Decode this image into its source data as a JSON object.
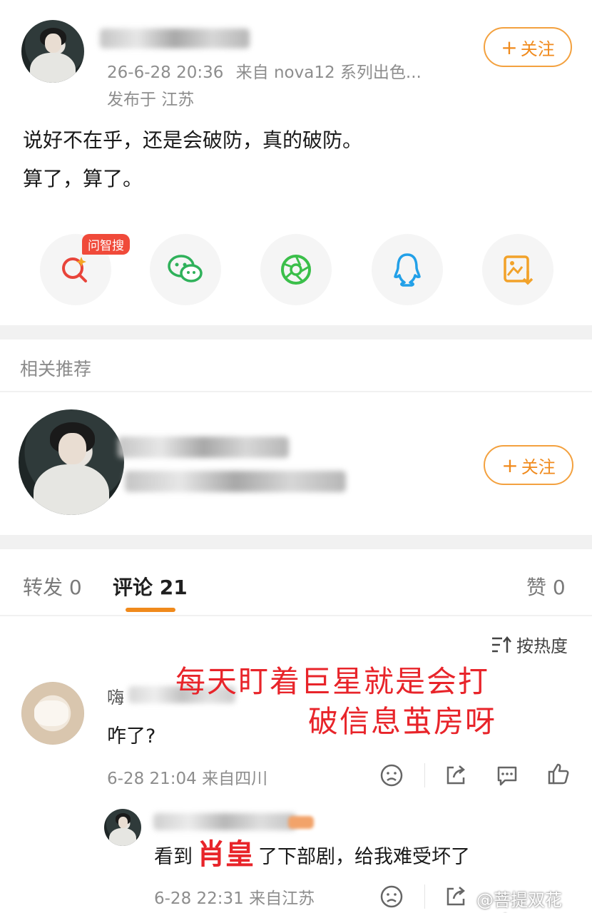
{
  "post": {
    "timestamp": "26-6-28 20:36",
    "source": "来自 nova12 系列出色...",
    "location": "发布于 江苏",
    "follow_label": "关注",
    "text_line1": "说好不在乎，还是会破防，真的破防。",
    "text_line2": "算了，算了。"
  },
  "share": {
    "badge": "问智搜",
    "items": [
      "search-ai-icon",
      "wechat-icon",
      "moments-icon",
      "qq-icon",
      "save-image-icon"
    ]
  },
  "recommend": {
    "header": "相关推荐",
    "follow_label": "关注"
  },
  "tabs": {
    "repost": "转发 0",
    "comments": "评论 21",
    "likes": "赞 0"
  },
  "sort": {
    "label": "按热度"
  },
  "overlay": {
    "line1": "每天盯着巨星就是会打",
    "line2": "破信息茧房呀"
  },
  "comment1": {
    "name_fragment": "嗨",
    "text": "咋了?",
    "meta": "6-28 21:04  来自四川"
  },
  "reply1": {
    "text_before": "看到",
    "highlight": "肖皇",
    "text_after": "了下部剧，给我难受坏了",
    "meta": "6-28 22:31  来自江苏"
  },
  "watermark": "@菩提双花yyds",
  "colors": {
    "accent_orange": "#f08a1c",
    "overlay_red": "#e8242a",
    "badge_red": "#f04a3a"
  }
}
